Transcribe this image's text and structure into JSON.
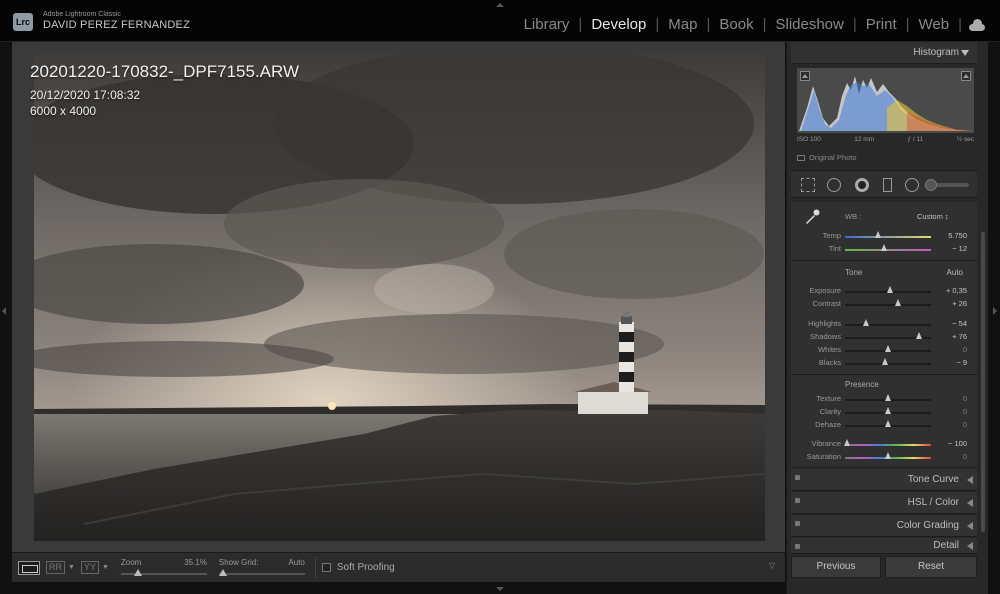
{
  "app": {
    "logo_text": "Lrc",
    "app_name": "Adobe Lightroom Classic",
    "user_name": "DAVID PEREZ FERNANDEZ"
  },
  "modules": [
    {
      "label": "Library",
      "active": false
    },
    {
      "label": "Develop",
      "active": true
    },
    {
      "label": "Map",
      "active": false
    },
    {
      "label": "Book",
      "active": false
    },
    {
      "label": "Slideshow",
      "active": false
    },
    {
      "label": "Print",
      "active": false
    },
    {
      "label": "Web",
      "active": false
    }
  ],
  "photo_info": {
    "filename": "20201220-170832-_DPF7155.ARW",
    "datetime": "20/12/2020 17:08:32",
    "dimensions": "6000 x 4000"
  },
  "toolbar": {
    "compare_label": "RR",
    "survey_label": "YY",
    "zoom_label": "Zoom",
    "zoom_value": "35.1%",
    "zoom_level": 0.2,
    "grid_label": "Show Grid:",
    "grid_value": "Auto",
    "grid_level": 0.05,
    "softproof_label": "Soft Proofing"
  },
  "histogram": {
    "title": "Histogram",
    "iso": "ISO 100",
    "focal": "12 mm",
    "aperture": "ƒ / 11",
    "shutter": "½ sec",
    "original_photo_label": "Original Photo"
  },
  "basic": {
    "wb_label": "WB :",
    "wb_value": "Custom ↕",
    "tone_title": "Tone",
    "tone_auto": "Auto",
    "presence_title": "Presence",
    "wb_rows": [
      {
        "label": "Temp",
        "value": "5.750",
        "level": 0.38
      },
      {
        "label": "Tint",
        "value": "− 12",
        "level": 0.45
      }
    ],
    "tone_rows": [
      {
        "label": "Exposure",
        "value": "+ 0,35",
        "level": 0.52
      },
      {
        "label": "Contrast",
        "value": "+ 26",
        "level": 0.62
      },
      {
        "label": "Highlights",
        "value": "− 54",
        "level": 0.24
      },
      {
        "label": "Shadows",
        "value": "+ 76",
        "level": 0.86
      },
      {
        "label": "Whites",
        "value": "0",
        "level": 0.5
      },
      {
        "label": "Blacks",
        "value": "− 9",
        "level": 0.46
      }
    ],
    "presence_rows": [
      {
        "label": "Texture",
        "value": "0",
        "level": 0.5
      },
      {
        "label": "Clarity",
        "value": "0",
        "level": 0.5
      },
      {
        "label": "Dehaze",
        "value": "0",
        "level": 0.5
      },
      {
        "label": "Vibrance",
        "value": "− 100",
        "level": 0.02
      },
      {
        "label": "Saturation",
        "value": "0",
        "level": 0.5
      }
    ]
  },
  "panels": [
    {
      "title": "Tone Curve"
    },
    {
      "title": "HSL / Color"
    },
    {
      "title": "Color Grading"
    },
    {
      "title": "Detail"
    }
  ],
  "buttons": {
    "previous": "Previous",
    "reset": "Reset"
  }
}
